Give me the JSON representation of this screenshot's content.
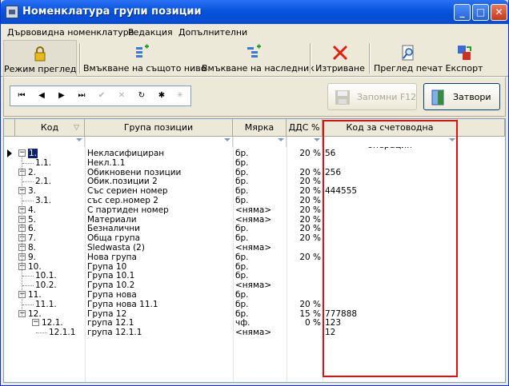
{
  "window": {
    "title": "Номенклатура групи позиции"
  },
  "titlebar_buttons": {
    "minimize": "_",
    "maximize": "□",
    "close": "✕"
  },
  "menu": [
    "Дървовидна номенклатура",
    "Редакция",
    "Допълнителни"
  ],
  "toolbar": {
    "view_mode": "Режим преглед",
    "insert_same": "Вмъкване на същото ниво",
    "insert_child": "Вмъкване на наследник",
    "delete": "Изтриване",
    "print_preview": "Преглед печат",
    "export": "Експорт"
  },
  "navigator": {
    "first": "⏮",
    "prior": "◀",
    "next": "▶",
    "last": "⏭",
    "post": "✔",
    "cancel": "✕",
    "refresh": "↻",
    "star": "✱",
    "star2": "✳"
  },
  "buttons": {
    "save": "Запомни  F12",
    "close": "Затвори"
  },
  "grid": {
    "columns": [
      "Код",
      "Група позиции",
      "Мярка",
      "ДДС %",
      "Код за счетоводна операция"
    ],
    "rows": [
      {
        "code": "1.",
        "name": "Некласифициран",
        "unit": "бр.",
        "vat": "20 %",
        "acc": "56",
        "level": 0,
        "selected": true
      },
      {
        "code": "1.1.",
        "name": "Некл.1.1",
        "unit": "бр.",
        "vat": "",
        "acc": "",
        "level": 1
      },
      {
        "code": "2.",
        "name": "Обикновени позиции",
        "unit": "бр.",
        "vat": "20 %",
        "acc": "256",
        "level": 0
      },
      {
        "code": "2.1.",
        "name": "Обик.позиции 2",
        "unit": "бр.",
        "vat": "20 %",
        "acc": "",
        "level": 1
      },
      {
        "code": "3.",
        "name": "Със сериен номер",
        "unit": "бр.",
        "vat": "20 %",
        "acc": "444555",
        "level": 0
      },
      {
        "code": "3.1.",
        "name": "със сер.номер 2",
        "unit": "бр.",
        "vat": "20 %",
        "acc": "",
        "level": 1
      },
      {
        "code": "4.",
        "name": "С партиден номер",
        "unit": "<няма>",
        "vat": "20 %",
        "acc": "",
        "level": 0
      },
      {
        "code": "5.",
        "name": "Материали",
        "unit": "<няма>",
        "vat": "20 %",
        "acc": "",
        "level": 0
      },
      {
        "code": "6.",
        "name": "Безналични",
        "unit": "бр.",
        "vat": "20 %",
        "acc": "",
        "level": 0
      },
      {
        "code": "7.",
        "name": "Обща група",
        "unit": "бр.",
        "vat": "20 %",
        "acc": "",
        "level": 0
      },
      {
        "code": "8.",
        "name": "Sledwasta (2)",
        "unit": "<няма>",
        "vat": "",
        "acc": "",
        "level": 0
      },
      {
        "code": "9.",
        "name": "Нова група",
        "unit": "бр.",
        "vat": "20 %",
        "acc": "",
        "level": 0
      },
      {
        "code": "10.",
        "name": "Група 10",
        "unit": "бр.",
        "vat": "",
        "acc": "",
        "level": 0
      },
      {
        "code": "10.1.",
        "name": "Група 10.1",
        "unit": "бр.",
        "vat": "",
        "acc": "",
        "level": 1
      },
      {
        "code": "10.2.",
        "name": "Група 10.2",
        "unit": "<няма>",
        "vat": "",
        "acc": "",
        "level": 1
      },
      {
        "code": "11.",
        "name": "Група нова",
        "unit": "бр.",
        "vat": "",
        "acc": "",
        "level": 0
      },
      {
        "code": "11.1.",
        "name": "Група нова 11.1",
        "unit": "бр.",
        "vat": "20 %",
        "acc": "",
        "level": 1
      },
      {
        "code": "12.",
        "name": "Група 12",
        "unit": "бр.",
        "vat": "15 %",
        "acc": "777888",
        "level": 0
      },
      {
        "code": "12.1.",
        "name": "група 12.1",
        "unit": "чф.",
        "vat": "0 %",
        "acc": "123",
        "level": 1
      },
      {
        "code": "12.1.1",
        "name": "група 12.1.1",
        "unit": "<няма>",
        "vat": "",
        "acc": "12",
        "level": 2
      }
    ]
  },
  "colors": {
    "highlight_box": "#e01010",
    "selection": "#0a246a"
  }
}
